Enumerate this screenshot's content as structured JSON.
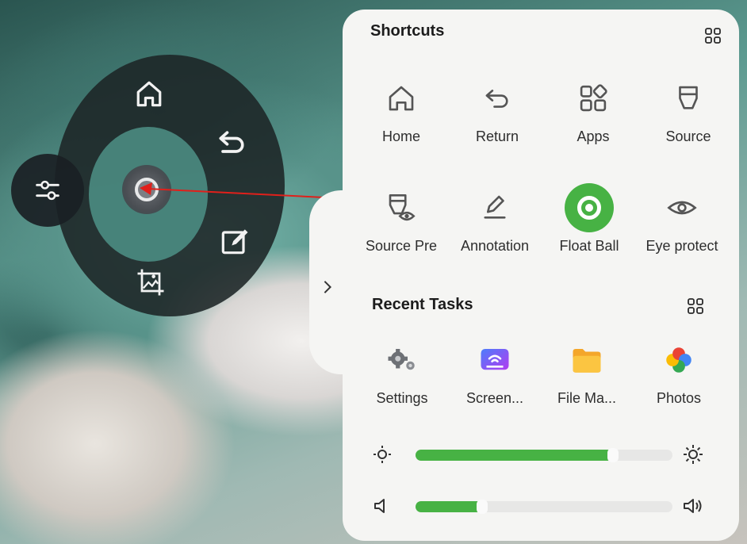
{
  "shortcuts": {
    "title": "Shortcuts",
    "items": [
      {
        "label": "Home",
        "icon": "home-icon"
      },
      {
        "label": "Return",
        "icon": "return-icon"
      },
      {
        "label": "Apps",
        "icon": "apps-icon"
      },
      {
        "label": "Source",
        "icon": "source-icon"
      },
      {
        "label": "Source Pre",
        "icon": "source-preview-icon"
      },
      {
        "label": "Annotation",
        "icon": "annotation-icon"
      },
      {
        "label": "Float Ball",
        "icon": "float-ball-icon"
      },
      {
        "label": "Eye protect",
        "icon": "eye-icon"
      }
    ]
  },
  "recent_tasks": {
    "title": "Recent Tasks",
    "items": [
      {
        "label": "Settings",
        "icon": "settings-gears-icon"
      },
      {
        "label": "Screen...",
        "icon": "screen-share-icon"
      },
      {
        "label": "File Ma...",
        "icon": "folder-icon"
      },
      {
        "label": "Photos",
        "icon": "photos-pinwheel-icon"
      }
    ]
  },
  "brightness": {
    "level_percent": 77
  },
  "volume": {
    "level_percent": 26
  },
  "colors": {
    "accent": "#47b244",
    "panel": "#f5f5f3",
    "menu": "#1c2426",
    "arrow": "#e0201b"
  }
}
